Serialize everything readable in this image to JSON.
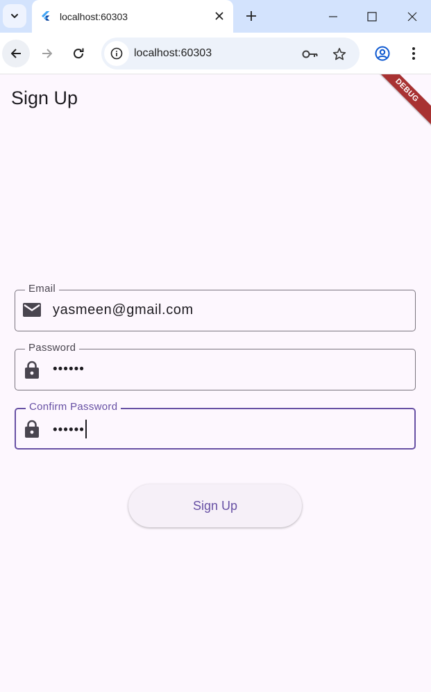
{
  "browser": {
    "tab": {
      "title": "localhost:60303"
    },
    "omnibox": {
      "url": "localhost:60303"
    }
  },
  "app": {
    "title": "Sign Up",
    "debug_banner": "DEBUG",
    "form": {
      "email": {
        "label": "Email",
        "value": "yasmeen@gmail.com",
        "icon": "email-icon"
      },
      "password": {
        "label": "Password",
        "value": "••••••",
        "icon": "lock-icon"
      },
      "confirm_password": {
        "label": "Confirm Password",
        "value": "••••••",
        "icon": "lock-icon",
        "focused": true
      }
    },
    "submit_label": "Sign Up"
  },
  "colors": {
    "primary": "#6750a4",
    "surface": "#fdf7fe",
    "tabstrip": "#d3e3fd",
    "debug": "#a83232"
  }
}
